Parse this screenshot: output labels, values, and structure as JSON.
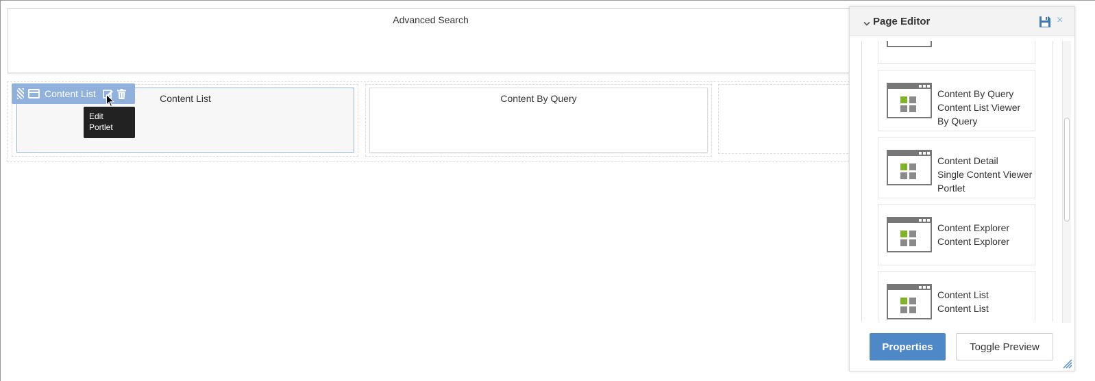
{
  "page": {
    "portlets": {
      "advanced_search": {
        "title": "Advanced Search"
      },
      "content_list": {
        "title": "Content List"
      },
      "content_by_query": {
        "title": "Content By Query"
      }
    },
    "toolbar": {
      "label": "Content List"
    },
    "tooltip": {
      "line1": "Edit",
      "line2": "Portlet"
    }
  },
  "editor": {
    "title": "Page Editor",
    "cards": [
      {
        "name": "Content By Query",
        "description": "Content List Viewer By Query"
      },
      {
        "name": "Content Detail",
        "description": "Single Content Viewer Portlet"
      },
      {
        "name": "Content Explorer",
        "description": "Content Explorer"
      },
      {
        "name": "Content List",
        "description": "Content List"
      }
    ],
    "buttons": {
      "properties": "Properties",
      "toggle_preview": "Toggle Preview"
    }
  },
  "colors": {
    "toolbar": "#8fb1db",
    "primary_button": "#4e88c7",
    "thumb_green": "#7fb32a",
    "thumb_gray": "#8a8a8a"
  },
  "icons": {
    "drag": "drag-handle-icon",
    "window": "window-icon",
    "edit": "edit-icon",
    "delete": "trash-icon",
    "save": "floppy-disk-icon",
    "close": "close-icon",
    "collapse": "chevron-down-icon"
  }
}
